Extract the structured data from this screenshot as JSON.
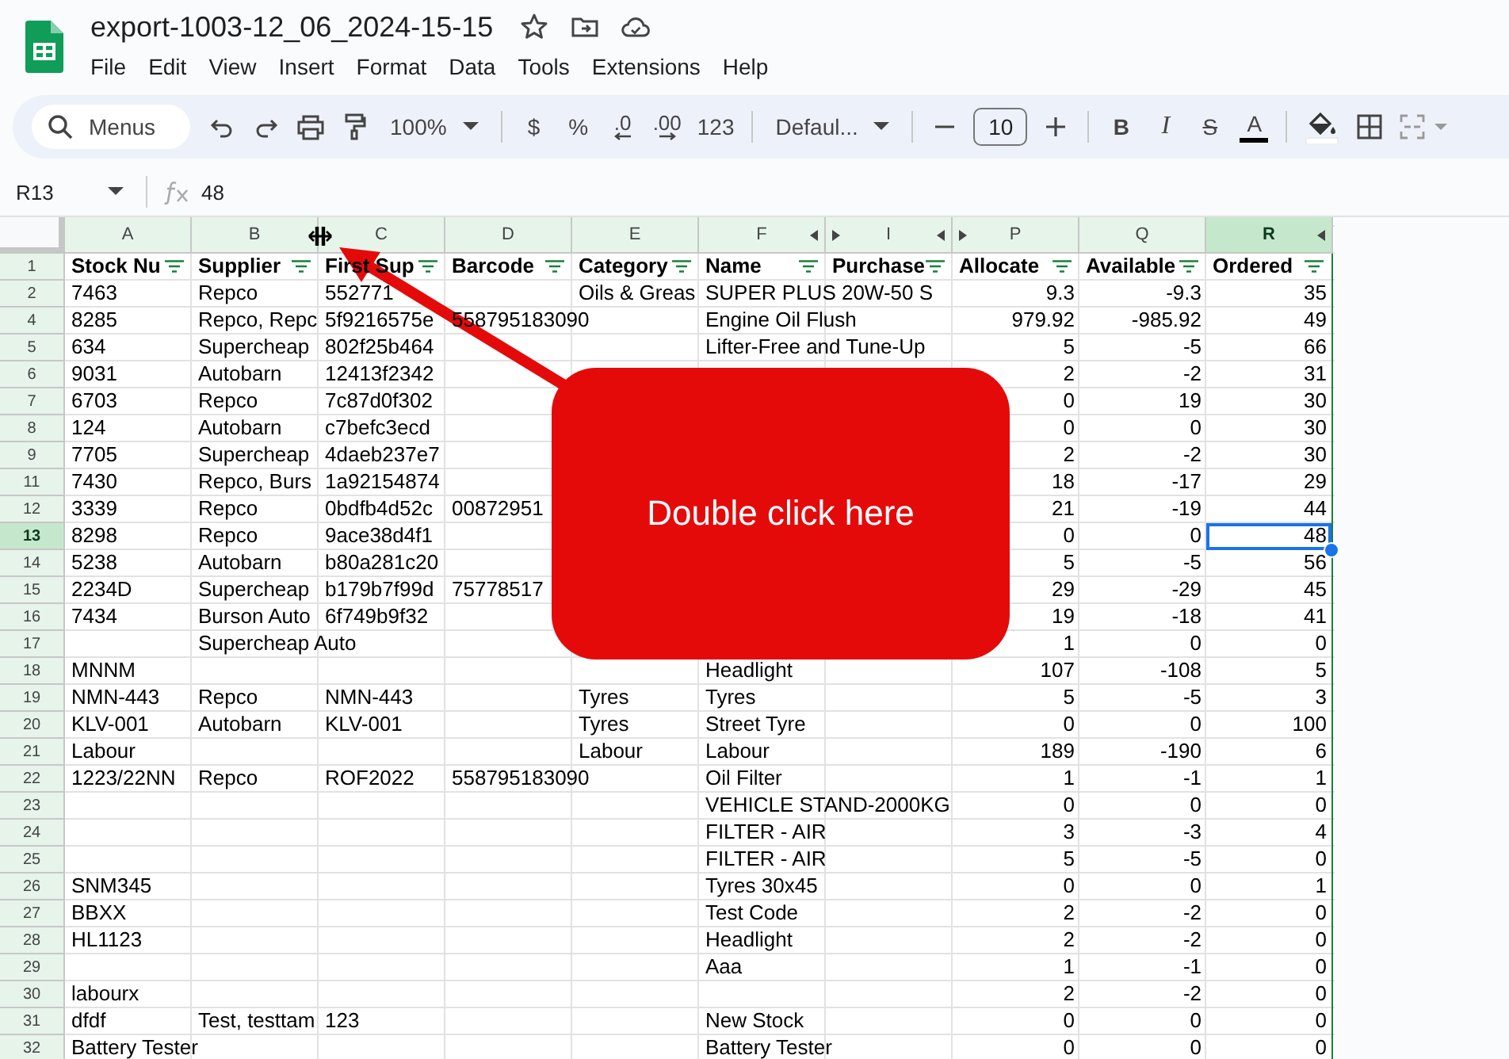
{
  "document": {
    "title": "export-1003-12_06_2024-15-15"
  },
  "menu": [
    "File",
    "Edit",
    "View",
    "Insert",
    "Format",
    "Data",
    "Tools",
    "Extensions",
    "Help"
  ],
  "toolbar": [
    {
      "kind": "search",
      "label": "Menus"
    },
    {
      "kind": "undo"
    },
    {
      "kind": "redo"
    },
    {
      "kind": "print"
    },
    {
      "kind": "paint-format"
    },
    {
      "kind": "dropdown",
      "label": "100%"
    },
    {
      "kind": "separator"
    },
    {
      "kind": "text",
      "label": "$"
    },
    {
      "kind": "text",
      "label": "%"
    },
    {
      "kind": "decimal-less",
      "label": ".0"
    },
    {
      "kind": "decimal-more",
      "label": ".00"
    },
    {
      "kind": "text",
      "label": "123"
    },
    {
      "kind": "separator"
    },
    {
      "kind": "dropdown",
      "label": "Defaul..."
    },
    {
      "kind": "separator"
    },
    {
      "kind": "minus"
    },
    {
      "kind": "field",
      "label": "10"
    },
    {
      "kind": "plus"
    },
    {
      "kind": "separator"
    },
    {
      "kind": "bold",
      "label": "B"
    },
    {
      "kind": "italic",
      "label": "I"
    },
    {
      "kind": "strike",
      "label": "S"
    },
    {
      "kind": "text-color",
      "label": "A"
    },
    {
      "kind": "separator"
    },
    {
      "kind": "fill"
    },
    {
      "kind": "borders"
    },
    {
      "kind": "merge"
    }
  ],
  "formula_bar": {
    "cell": "R13",
    "value": "48"
  },
  "columns": [
    {
      "letter": "A",
      "kind": "text",
      "selected": false,
      "hidden_left": false,
      "hidden_right": false
    },
    {
      "letter": "B",
      "kind": "text",
      "selected": false,
      "hidden_left": false,
      "hidden_right": false
    },
    {
      "letter": "C",
      "kind": "text",
      "selected": false,
      "hidden_left": false,
      "hidden_right": false
    },
    {
      "letter": "D",
      "kind": "text",
      "selected": false,
      "hidden_left": false,
      "hidden_right": false
    },
    {
      "letter": "E",
      "kind": "text",
      "selected": false,
      "hidden_left": false,
      "hidden_right": false
    },
    {
      "letter": "F",
      "kind": "text",
      "selected": false,
      "hidden_left": false,
      "hidden_right": true
    },
    {
      "letter": "I",
      "kind": "text",
      "selected": false,
      "hidden_left": true,
      "hidden_right": true
    },
    {
      "letter": "P",
      "kind": "number",
      "selected": false,
      "hidden_left": true,
      "hidden_right": false
    },
    {
      "letter": "Q",
      "kind": "number",
      "selected": false,
      "hidden_left": false,
      "hidden_right": false
    },
    {
      "letter": "R",
      "kind": "number",
      "selected": true,
      "hidden_left": false,
      "hidden_right": true
    }
  ],
  "header_row": {
    "number": "1",
    "cells": [
      "Stock Nu",
      "Supplier",
      "First Sup",
      "Barcode",
      "Category",
      "Name",
      "Purchase",
      "Allocate",
      "Available",
      "Ordered"
    ]
  },
  "rows": [
    {
      "number": "2",
      "selected": false,
      "cells": [
        "7463",
        "Repco",
        "552771",
        null,
        "Oils & Greas",
        "SUPER PLUS 20W-50 S",
        null,
        "9.3",
        "-9.3",
        "35"
      ]
    },
    {
      "number": "4",
      "selected": false,
      "cells": [
        "8285",
        "Repco, Repc",
        "5f9216575e",
        "558795183090",
        null,
        "Engine Oil Flush",
        null,
        "979.92",
        "-985.92",
        "49"
      ]
    },
    {
      "number": "5",
      "selected": false,
      "cells": [
        "634",
        "Supercheap",
        "802f25b464",
        null,
        null,
        "Lifter-Free and Tune-Up",
        null,
        "5",
        "-5",
        "66"
      ]
    },
    {
      "number": "6",
      "selected": false,
      "cells": [
        "9031",
        "Autobarn",
        "12413f2342",
        null,
        null,
        null,
        null,
        "2",
        "-2",
        "31"
      ]
    },
    {
      "number": "7",
      "selected": false,
      "cells": [
        "6703",
        "Repco",
        "7c87d0f302",
        null,
        null,
        null,
        null,
        "0",
        "19",
        "30"
      ]
    },
    {
      "number": "8",
      "selected": false,
      "cells": [
        "124",
        "Autobarn",
        "c7befc3ecd",
        null,
        null,
        null,
        null,
        "0",
        "0",
        "30"
      ]
    },
    {
      "number": "9",
      "selected": false,
      "cells": [
        "7705",
        "Supercheap",
        "4daeb237e7",
        null,
        null,
        null,
        null,
        "2",
        "-2",
        "30"
      ]
    },
    {
      "number": "11",
      "selected": false,
      "cells": [
        "7430",
        "Repco, Burs",
        "1a92154874",
        null,
        null,
        null,
        null,
        "18",
        "-17",
        "29"
      ]
    },
    {
      "number": "12",
      "selected": false,
      "cells": [
        "3339",
        "Repco",
        "0bdfb4d52c",
        "00872951",
        null,
        null,
        null,
        "21",
        "-19",
        "44"
      ]
    },
    {
      "number": "13",
      "selected": true,
      "cells": [
        "8298",
        "Repco",
        "9ace38d4f1",
        null,
        null,
        null,
        null,
        "0",
        "0",
        "48"
      ]
    },
    {
      "number": "14",
      "selected": false,
      "cells": [
        "5238",
        "Autobarn",
        "b80a281c20",
        null,
        null,
        null,
        null,
        "5",
        "-5",
        "56"
      ]
    },
    {
      "number": "15",
      "selected": false,
      "cells": [
        "2234D",
        "Supercheap",
        "b179b7f99d",
        "75778517",
        null,
        null,
        null,
        "29",
        "-29",
        "45"
      ]
    },
    {
      "number": "16",
      "selected": false,
      "cells": [
        "7434",
        "Burson Auto",
        "6f749b9f32",
        null,
        null,
        null,
        null,
        "19",
        "-18",
        "41"
      ]
    },
    {
      "number": "17",
      "selected": false,
      "cells": [
        null,
        "Supercheap Auto",
        null,
        null,
        null,
        null,
        null,
        "1",
        "0",
        "0"
      ]
    },
    {
      "number": "18",
      "selected": false,
      "cells": [
        "MNNM",
        null,
        null,
        null,
        null,
        "Headlight",
        null,
        "107",
        "-108",
        "5"
      ]
    },
    {
      "number": "19",
      "selected": false,
      "cells": [
        "NMN-443",
        "Repco",
        "NMN-443",
        null,
        "Tyres",
        "Tyres",
        null,
        "5",
        "-5",
        "3"
      ]
    },
    {
      "number": "20",
      "selected": false,
      "cells": [
        "KLV-001",
        "Autobarn",
        "KLV-001",
        null,
        "Tyres",
        "Street Tyre",
        null,
        "0",
        "0",
        "100"
      ]
    },
    {
      "number": "21",
      "selected": false,
      "cells": [
        "Labour",
        null,
        null,
        null,
        "Labour",
        "Labour",
        null,
        "189",
        "-190",
        "6"
      ]
    },
    {
      "number": "22",
      "selected": false,
      "cells": [
        "1223/22NN",
        "Repco",
        "ROF2022",
        "558795183090",
        null,
        "Oil Filter",
        null,
        "1",
        "-1",
        "1"
      ]
    },
    {
      "number": "23",
      "selected": false,
      "cells": [
        null,
        null,
        null,
        null,
        null,
        "VEHICLE STAND-2000KG",
        null,
        "0",
        "0",
        "0"
      ]
    },
    {
      "number": "24",
      "selected": false,
      "cells": [
        null,
        null,
        null,
        null,
        null,
        "FILTER - AIR",
        null,
        "3",
        "-3",
        "4"
      ]
    },
    {
      "number": "25",
      "selected": false,
      "cells": [
        null,
        null,
        null,
        null,
        null,
        "FILTER - AIR",
        null,
        "5",
        "-5",
        "0"
      ]
    },
    {
      "number": "26",
      "selected": false,
      "cells": [
        "SNM345",
        null,
        null,
        null,
        null,
        "Tyres 30x45",
        null,
        "0",
        "0",
        "1"
      ]
    },
    {
      "number": "27",
      "selected": false,
      "cells": [
        "BBXX",
        null,
        null,
        null,
        null,
        "Test Code",
        null,
        "2",
        "-2",
        "0"
      ]
    },
    {
      "number": "28",
      "selected": false,
      "cells": [
        "HL1123",
        null,
        null,
        null,
        null,
        "Headlight",
        null,
        "2",
        "-2",
        "0"
      ]
    },
    {
      "number": "29",
      "selected": false,
      "cells": [
        null,
        null,
        null,
        null,
        null,
        "Aaa",
        null,
        "1",
        "-1",
        "0"
      ]
    },
    {
      "number": "30",
      "selected": false,
      "cells": [
        "labourx",
        null,
        null,
        null,
        null,
        null,
        null,
        "2",
        "-2",
        "0"
      ]
    },
    {
      "number": "31",
      "selected": false,
      "cells": [
        "dfdf",
        "Test, testtam",
        "123",
        null,
        null,
        "New Stock",
        null,
        "0",
        "0",
        "0"
      ]
    },
    {
      "number": "32",
      "selected": false,
      "cells": [
        "Battery Tester",
        null,
        null,
        null,
        null,
        "Battery Tester",
        null,
        "0",
        "0",
        "0"
      ]
    }
  ],
  "callout": {
    "text": "Double click here"
  }
}
